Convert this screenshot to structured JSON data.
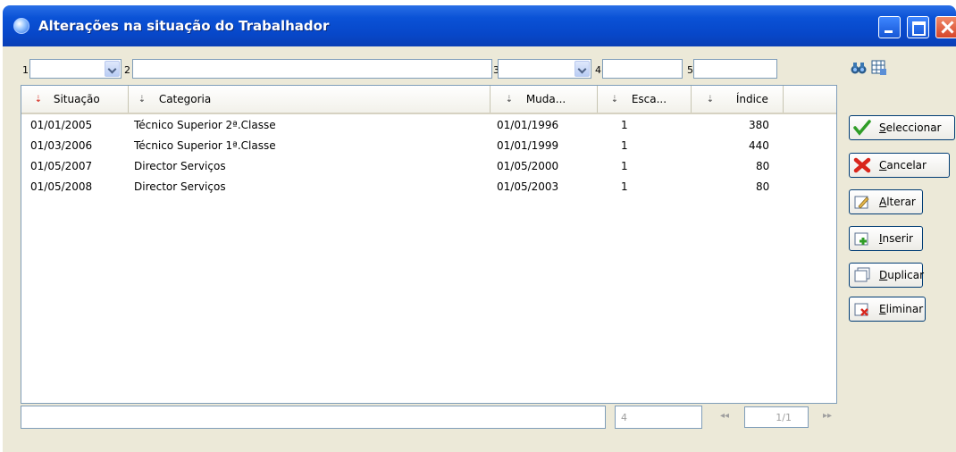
{
  "window": {
    "title": "Alterações na situação do Trabalhador",
    "controls": [
      "minimize",
      "maximize",
      "close"
    ]
  },
  "filters": {
    "labels": [
      "1",
      "2",
      "3",
      "4",
      "5"
    ],
    "values": [
      "",
      "",
      "",
      "",
      ""
    ]
  },
  "grid": {
    "columns": [
      "Situação",
      "Categoria",
      "Muda...",
      "Esca...",
      "Índice"
    ],
    "rows": [
      {
        "situacao": "01/01/2005",
        "categoria": "Técnico Superior 2ª.Classe",
        "muda": "01/01/1996",
        "esca": "1",
        "indice": "380"
      },
      {
        "situacao": "01/03/2006",
        "categoria": "Técnico Superior 1ª.Classe",
        "muda": "01/01/1999",
        "esca": "1",
        "indice": "440"
      },
      {
        "situacao": "01/05/2007",
        "categoria": "Director Serviços",
        "muda": "01/05/2000",
        "esca": "1",
        "indice": "80"
      },
      {
        "situacao": "01/05/2008",
        "categoria": "Director Serviços",
        "muda": "01/05/2003",
        "esca": "1",
        "indice": "80"
      }
    ]
  },
  "footer": {
    "record_count": "4",
    "page": "1/1"
  },
  "actions": [
    {
      "key": "S",
      "rest": "eleccionar",
      "icon": "check-icon"
    },
    {
      "key": "C",
      "rest": "ancelar",
      "icon": "cancel-x-icon"
    },
    {
      "key": "A",
      "rest": "lterar",
      "icon": "edit-pencil-icon"
    },
    {
      "key": "I",
      "rest": "nserir",
      "icon": "insert-plus-icon"
    },
    {
      "key": "D",
      "rest": "uplicar",
      "icon": "duplicate-icon"
    },
    {
      "key": "E",
      "rest": "liminar",
      "icon": "delete-icon"
    }
  ],
  "colors": {
    "titlebar": "#0a52d6",
    "face": "#ece9d8",
    "sort_icon_active": "#d62b1f"
  }
}
